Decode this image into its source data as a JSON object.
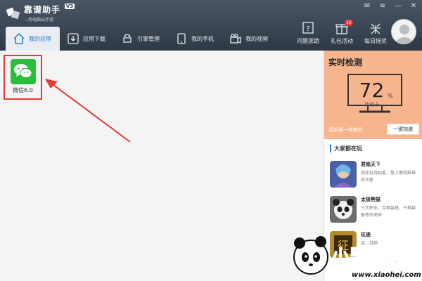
{
  "app": {
    "title": "靠谱助手",
    "version": "V3",
    "subtitle": "—用电脑玩手游"
  },
  "nav": {
    "tabs": [
      {
        "label": "我的应用",
        "icon": "home-icon",
        "active": true
      },
      {
        "label": "应用下载",
        "icon": "download-icon",
        "active": false
      },
      {
        "label": "引擎管理",
        "icon": "android-icon",
        "active": false
      },
      {
        "label": "我的手机",
        "icon": "phone-icon",
        "active": false
      },
      {
        "label": "我的视频",
        "icon": "video-icon",
        "active": false
      }
    ]
  },
  "tools": [
    {
      "label": "问题求助",
      "icon": "help-icon"
    },
    {
      "label": "礼包活动",
      "icon": "gift-icon",
      "badge": "10"
    },
    {
      "label": "每日摇奖",
      "icon": "lottery-icon"
    }
  ],
  "apps": [
    {
      "label": "微信6.0",
      "icon": "wechat-icon",
      "color": "#2bbd3c"
    }
  ],
  "realtime": {
    "title": "实时检测",
    "score": "72",
    "unit": "%",
    "compare": "比较卡",
    "tip": "请关掉一些软件",
    "button": "一键加速"
  },
  "popular": {
    "title": "大家都在玩",
    "games": [
      {
        "name": "君临天下",
        "desc": "四比征战招募，登上傲视群雄的王座"
      },
      {
        "name": "太极熊猫",
        "desc": "三大职业，百种装搭，千种装备等你来弄"
      },
      {
        "name": "征途",
        "desc": "金，战场"
      }
    ]
  },
  "watermark": {
    "text": "小黑游戏",
    "url": "www.xiaohei.com"
  },
  "colors": {
    "topbar": "#2f3946",
    "accent": "#1f7fd1",
    "realtime_bg": "#f7b58e",
    "highlight": "#e53935",
    "wechat": "#2bbd3c"
  }
}
